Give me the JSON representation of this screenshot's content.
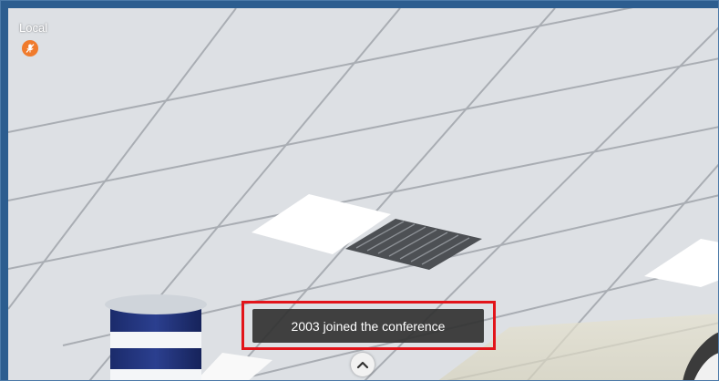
{
  "video": {
    "local_label": "Local"
  },
  "icons": {
    "mic_status": "mic-muted-icon",
    "expand": "chevron-up-icon"
  },
  "notification": {
    "message": "2003 joined the conference"
  },
  "colors": {
    "mute_badge": "#f07b2c",
    "highlight_border": "#e2141a",
    "toast_background": "#323232",
    "frame_border": "#4b79a8"
  }
}
